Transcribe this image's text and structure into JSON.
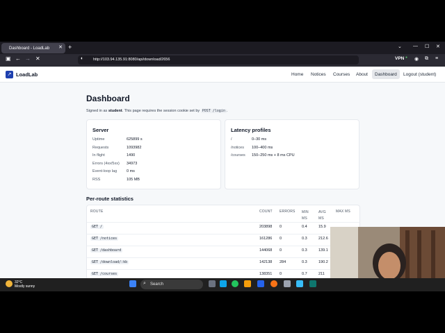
{
  "browser": {
    "tab_title": "Dashboard - LoadLab",
    "url": "http://103.94.135.91:8080/api/download/2656",
    "vpn_label": "VPN"
  },
  "site": {
    "logo_text": "LoadLab",
    "nav": [
      "Home",
      "Notices",
      "Courses",
      "About",
      "Dashboard",
      "Logout (student)"
    ]
  },
  "main": {
    "title": "Dashboard",
    "signed_prefix": "Signed in as ",
    "signed_user": "student",
    "signed_middle": ". This page requires the session cookie set by ",
    "signed_code": "POST /login",
    "signed_suffix": "."
  },
  "server": {
    "title": "Server",
    "rows": [
      {
        "label": "Uptime",
        "value": "625899 s"
      },
      {
        "label": "Requests",
        "value": "1093982"
      },
      {
        "label": "In flight",
        "value": "1490"
      },
      {
        "label": "Errors (4xx/5xx)",
        "value": "34973"
      },
      {
        "label": "Event-loop lag",
        "value": "0 ms"
      },
      {
        "label": "RSS",
        "value": "105 MB"
      }
    ]
  },
  "latency": {
    "title": "Latency profiles",
    "rows": [
      {
        "label": "/",
        "value": "0–30 ms"
      },
      {
        "label": "/notices",
        "value": "100–400 ms"
      },
      {
        "label": "/courses",
        "value": "150–250 ms + 8 ms CPU"
      }
    ]
  },
  "per_route": {
    "title": "Per-route statistics",
    "headers": [
      "ROUTE",
      "COUNT",
      "ERRORS",
      "MIN MS",
      "AVG MS",
      "MAX MS"
    ],
    "rows": [
      {
        "route": "GET /",
        "count": "203898",
        "errors": "0",
        "min": "0.4",
        "avg": "15.9"
      },
      {
        "route": "GET /notices",
        "count": "161286",
        "errors": "0",
        "min": "0.3",
        "avg": "212.6"
      },
      {
        "route": "GET /dashboard",
        "count": "144068",
        "errors": "0",
        "min": "0.3",
        "avg": "139.1"
      },
      {
        "route": "GET /download/:kb",
        "count": "142138",
        "errors": "284",
        "min": "0.3",
        "avg": "190.2"
      },
      {
        "route": "GET /courses",
        "count": "138351",
        "errors": "0",
        "min": "0.7",
        "avg": "211"
      }
    ]
  },
  "taskbar": {
    "temp": "32°C",
    "condition": "Mostly sunny",
    "search_label": "Search"
  }
}
